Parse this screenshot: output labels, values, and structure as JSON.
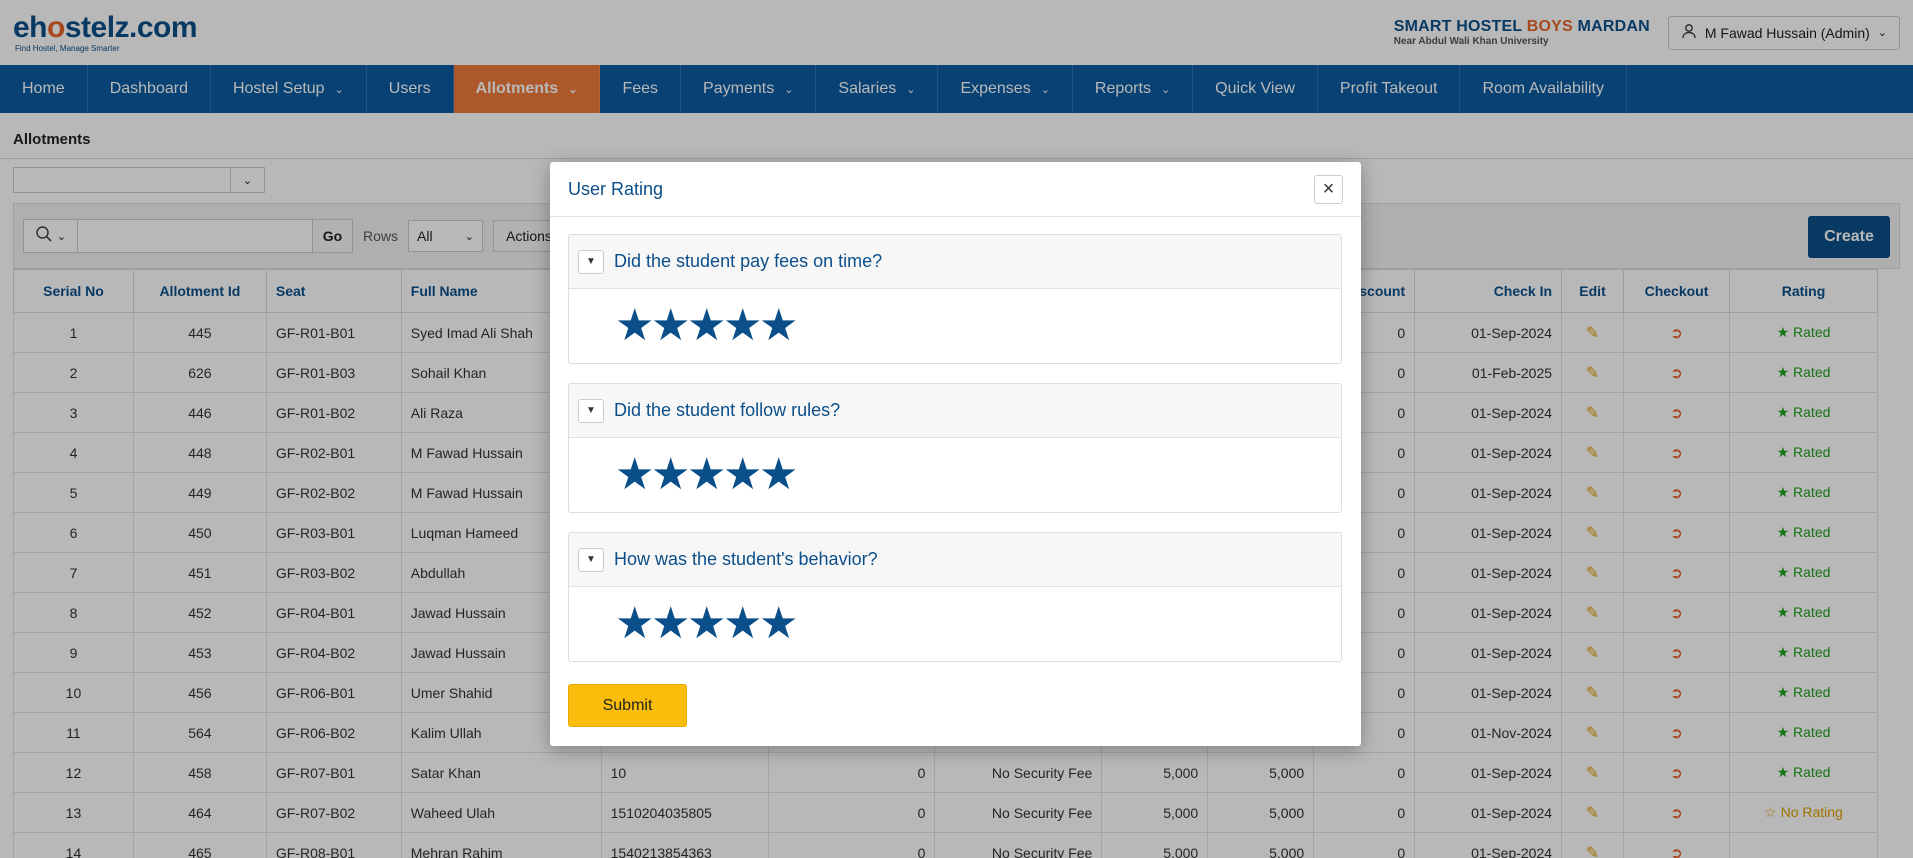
{
  "header": {
    "logo_left": "eh",
    "logo_o": "o",
    "logo_right": "stelz.com",
    "logo_tagline": "Find Hostel, Manage Smarter",
    "brand_part1": "SMART HOSTEL ",
    "brand_boys": "BOYS",
    "brand_part2": " MARDAN",
    "brand_sub": "Near Abdul Wali Khan University",
    "user_name": "M Fawad Hussain (Admin)"
  },
  "nav": {
    "items": [
      {
        "label": "Home",
        "dropdown": false
      },
      {
        "label": "Dashboard",
        "dropdown": false
      },
      {
        "label": "Hostel Setup",
        "dropdown": true
      },
      {
        "label": "Users",
        "dropdown": false
      },
      {
        "label": "Allotments",
        "dropdown": true,
        "active": true
      },
      {
        "label": "Fees",
        "dropdown": false
      },
      {
        "label": "Payments",
        "dropdown": true
      },
      {
        "label": "Salaries",
        "dropdown": true
      },
      {
        "label": "Expenses",
        "dropdown": true
      },
      {
        "label": "Reports",
        "dropdown": true
      },
      {
        "label": "Quick View",
        "dropdown": false
      },
      {
        "label": "Profit Takeout",
        "dropdown": false
      },
      {
        "label": "Room Availability",
        "dropdown": false
      }
    ]
  },
  "page": {
    "title": "Allotments",
    "toolbar": {
      "go_label": "Go",
      "rows_label": "Rows",
      "rows_value": "All",
      "actions_label": "Actions",
      "create_label": "Create"
    }
  },
  "table": {
    "headers": {
      "serial": "Serial No",
      "allotment_id": "Allotment Id",
      "seat": "Seat",
      "full_name": "Full Name",
      "discount": "Discount",
      "check_in": "Check In",
      "edit": "Edit",
      "checkout": "Checkout",
      "rating": "Rating"
    },
    "rows": [
      {
        "serial": "1",
        "id": "445",
        "seat": "GF-R01-B01",
        "name": "Syed Imad Ali Shah",
        "cnic": "",
        "c1": "",
        "security": "",
        "f1": "",
        "f2": "",
        "discount": "0",
        "check_in": "01-Sep-2024",
        "rating": "Rated"
      },
      {
        "serial": "2",
        "id": "626",
        "seat": "GF-R01-B03",
        "name": "Sohail Khan",
        "cnic": "",
        "c1": "",
        "security": "",
        "f1": "",
        "f2": "",
        "discount": "0",
        "check_in": "01-Feb-2025",
        "rating": "Rated"
      },
      {
        "serial": "3",
        "id": "446",
        "seat": "GF-R01-B02",
        "name": "Ali Raza",
        "cnic": "",
        "c1": "",
        "security": "",
        "f1": "",
        "f2": "",
        "discount": "0",
        "check_in": "01-Sep-2024",
        "rating": "Rated"
      },
      {
        "serial": "4",
        "id": "448",
        "seat": "GF-R02-B01",
        "name": "M Fawad Hussain",
        "cnic": "",
        "c1": "",
        "security": "",
        "f1": "",
        "f2": "",
        "discount": "0",
        "check_in": "01-Sep-2024",
        "rating": "Rated"
      },
      {
        "serial": "5",
        "id": "449",
        "seat": "GF-R02-B02",
        "name": "M Fawad Hussain",
        "cnic": "",
        "c1": "",
        "security": "",
        "f1": "",
        "f2": "",
        "discount": "0",
        "check_in": "01-Sep-2024",
        "rating": "Rated"
      },
      {
        "serial": "6",
        "id": "450",
        "seat": "GF-R03-B01",
        "name": "Luqman Hameed",
        "cnic": "",
        "c1": "",
        "security": "",
        "f1": "",
        "f2": "",
        "discount": "0",
        "check_in": "01-Sep-2024",
        "rating": "Rated"
      },
      {
        "serial": "7",
        "id": "451",
        "seat": "GF-R03-B02",
        "name": "Abdullah",
        "cnic": "",
        "c1": "",
        "security": "",
        "f1": "",
        "f2": "",
        "discount": "0",
        "check_in": "01-Sep-2024",
        "rating": "Rated"
      },
      {
        "serial": "8",
        "id": "452",
        "seat": "GF-R04-B01",
        "name": "Jawad Hussain",
        "cnic": "",
        "c1": "",
        "security": "",
        "f1": "",
        "f2": "",
        "discount": "0",
        "check_in": "01-Sep-2024",
        "rating": "Rated"
      },
      {
        "serial": "9",
        "id": "453",
        "seat": "GF-R04-B02",
        "name": "Jawad Hussain",
        "cnic": "",
        "c1": "",
        "security": "",
        "f1": "",
        "f2": "",
        "discount": "0",
        "check_in": "01-Sep-2024",
        "rating": "Rated"
      },
      {
        "serial": "10",
        "id": "456",
        "seat": "GF-R06-B01",
        "name": "Umer Shahid",
        "cnic": "",
        "c1": "",
        "security": "",
        "f1": "",
        "f2": "",
        "discount": "0",
        "check_in": "01-Sep-2024",
        "rating": "Rated"
      },
      {
        "serial": "11",
        "id": "564",
        "seat": "GF-R06-B02",
        "name": "Kalim Ullah",
        "cnic": "",
        "c1": "",
        "security": "",
        "f1": "",
        "f2": "",
        "discount": "0",
        "check_in": "01-Nov-2024",
        "rating": "Rated"
      },
      {
        "serial": "12",
        "id": "458",
        "seat": "GF-R07-B01",
        "name": "Satar Khan",
        "cnic": "10",
        "c1": "0",
        "security": "No Security Fee",
        "f1": "5,000",
        "f2": "5,000",
        "discount": "0",
        "check_in": "01-Sep-2024",
        "rating": "Rated"
      },
      {
        "serial": "13",
        "id": "464",
        "seat": "GF-R07-B02",
        "name": "Waheed Ulah",
        "cnic": "1510204035805",
        "c1": "0",
        "security": "No Security Fee",
        "f1": "5,000",
        "f2": "5,000",
        "discount": "0",
        "check_in": "01-Sep-2024",
        "rating": "No Rating"
      },
      {
        "serial": "14",
        "id": "465",
        "seat": "GF-R08-B01",
        "name": "Mehran Rahim",
        "cnic": "1540213854363",
        "c1": "0",
        "security": "No Security Fee",
        "f1": "5,000",
        "f2": "5,000",
        "discount": "0",
        "check_in": "01-Sep-2024",
        "rating": ""
      }
    ]
  },
  "modal": {
    "title": "User Rating",
    "questions": [
      {
        "text": "Did the student pay fees on time?",
        "stars": 5
      },
      {
        "text": "Did the student follow rules?",
        "stars": 5
      },
      {
        "text": "How was the student's behavior?",
        "stars": 5
      }
    ],
    "submit_label": "Submit"
  },
  "colors": {
    "primary": "#0b4f8a",
    "nav_bg": "#0c5aa0",
    "nav_active": "#f07a3c",
    "submit": "#fbbd0b",
    "rated": "#1fa01f",
    "no_rating": "#e0a000"
  }
}
